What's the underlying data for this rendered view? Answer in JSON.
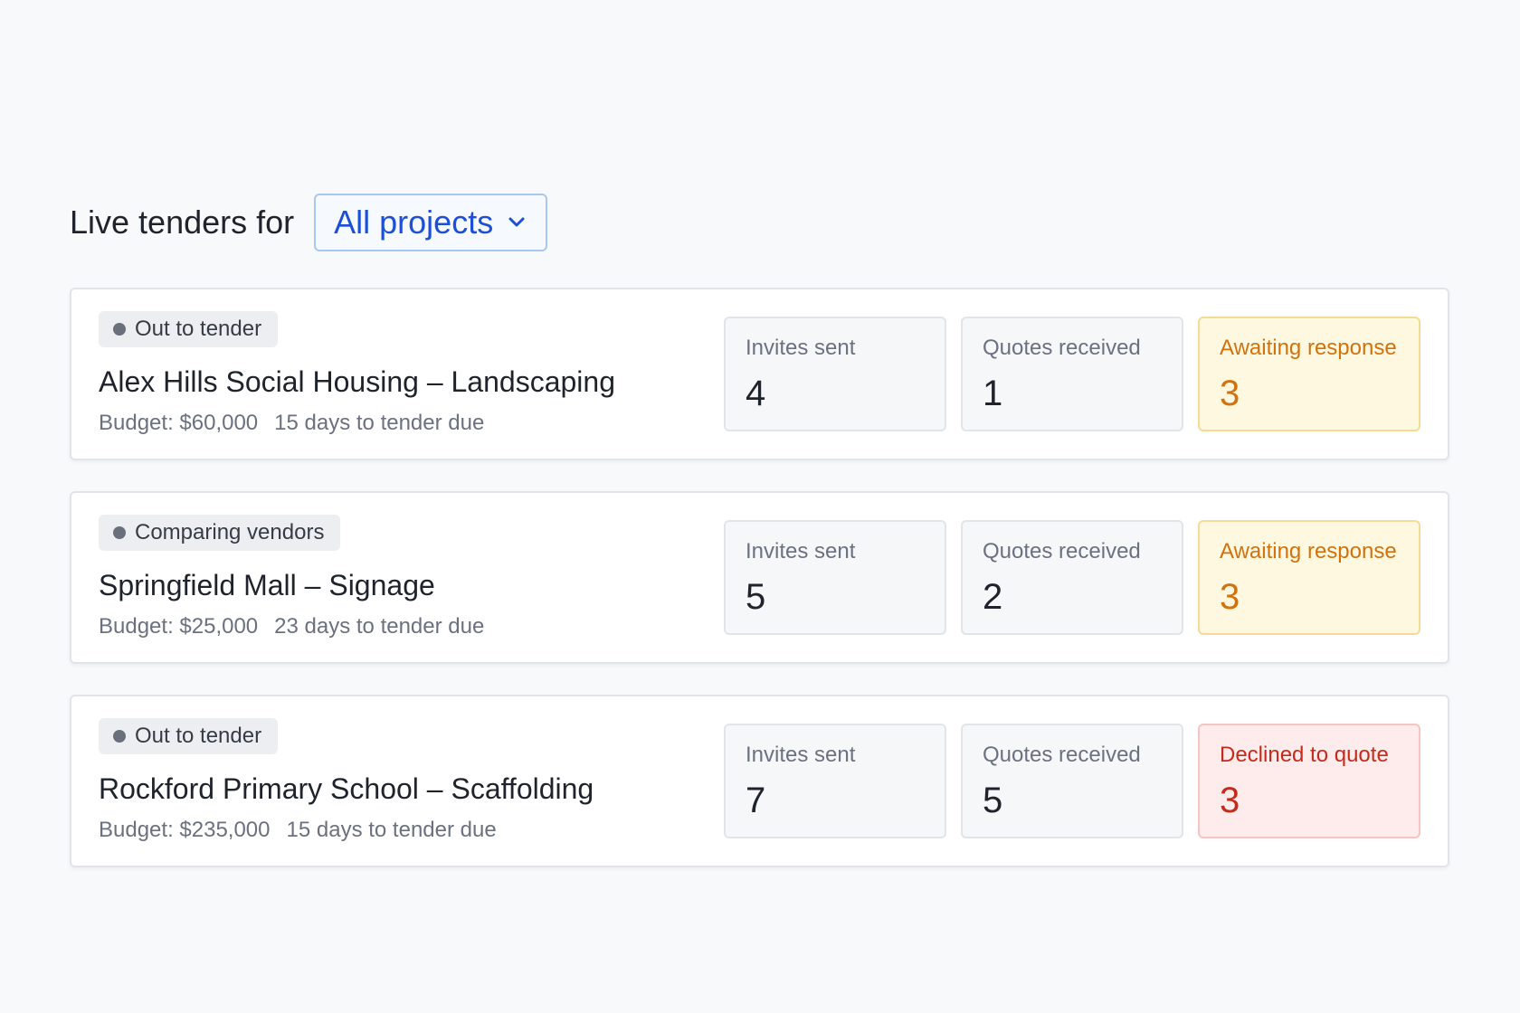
{
  "header": {
    "label": "Live tenders for",
    "project_filter": {
      "value": "All projects",
      "icon": "chevron-down-icon"
    }
  },
  "tenders": [
    {
      "status": "Out to tender",
      "title": "Alex Hills Social Housing – Landscaping",
      "budget": "Budget: $60,000",
      "due": "15 days to tender due",
      "stats": [
        {
          "label": "Invites sent",
          "value": "4"
        },
        {
          "label": "Quotes received",
          "value": "1"
        },
        {
          "label": "Awaiting response",
          "value": "3"
        }
      ]
    },
    {
      "status": "Comparing vendors",
      "title": "Springfield Mall – Signage",
      "budget": "Budget: $25,000",
      "due": "23 days to tender due",
      "stats": [
        {
          "label": "Invites sent",
          "value": "5"
        },
        {
          "label": "Quotes received",
          "value": "2"
        },
        {
          "label": "Awaiting response",
          "value": "3"
        }
      ]
    },
    {
      "status": "Out to tender",
      "title": "Rockford Primary School – Scaffolding",
      "budget": "Budget: $235,000",
      "due": "15 days to tender due",
      "stats": [
        {
          "label": "Invites sent",
          "value": "7"
        },
        {
          "label": "Quotes received",
          "value": "5"
        },
        {
          "label": "Declined to quote",
          "value": "3"
        }
      ]
    }
  ],
  "colors": {
    "accent": "#1d4fd7",
    "awaiting": "#d2720d",
    "declined": "#c52a1c",
    "status_dot": "#6a6f7c"
  }
}
